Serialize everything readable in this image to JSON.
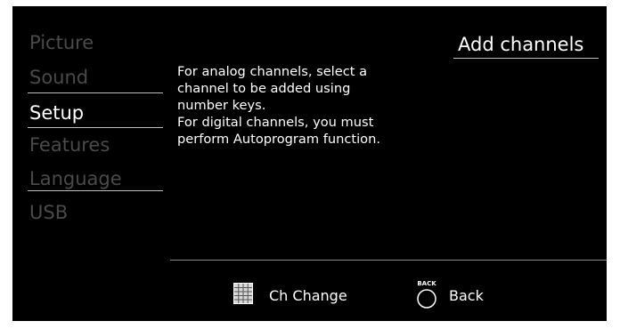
{
  "menu": {
    "items": [
      {
        "label": "Picture",
        "active": false
      },
      {
        "label": "Sound",
        "active": false
      },
      {
        "label": "Setup",
        "active": true
      },
      {
        "label": "Features",
        "active": false
      },
      {
        "label": "Language",
        "active": false
      },
      {
        "label": "USB",
        "active": false
      }
    ]
  },
  "panel": {
    "title": "Add channels",
    "description_lines": [
      "For analog channels, select a",
      "channel to be added using",
      "number keys.",
      "For digital channels, you must",
      "perform Autoprogram function."
    ]
  },
  "hints": {
    "ch_change_label": "Ch Change",
    "back_label": "Back",
    "back_icon_text": "BACK"
  },
  "colors": {
    "background": "#000000",
    "active_text": "#ffffff",
    "inactive_text": "#4a4a4a",
    "divider": "#bdbdbd"
  },
  "icons": {
    "ch_change": "grid-keypad-icon",
    "back": "back-button-icon"
  }
}
